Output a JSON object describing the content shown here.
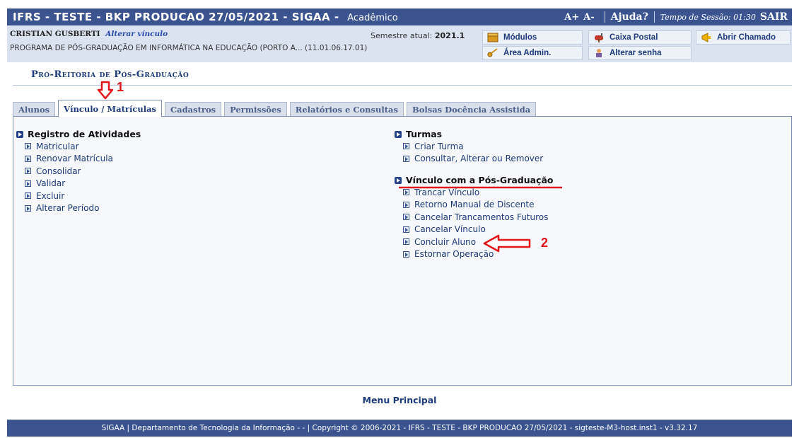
{
  "header": {
    "title": "IFRS - TESTE - BKP PRODUCAO 27/05/2021 - SIGAA -",
    "subsystem": "Acadêmico",
    "font_increase": "A+",
    "font_decrease": "A-",
    "help": "Ajuda?",
    "session": "Tempo de Sessão: 01:30",
    "logout": "SAIR"
  },
  "user_info": {
    "name": "CRISTIAN GUSBERTI",
    "change_link": "Alterar vínculo",
    "program": "PROGRAMA DE PÓS-GRADUAÇÃO EM INFORMÁTICA NA EDUCAÇÃO (PORTO A... (11.01.06.17.01)",
    "semester_label": "Semestre atual:",
    "semester_value": "2021.1"
  },
  "shortcuts": {
    "modulos": "Módulos",
    "caixa_postal": "Caixa Postal",
    "abrir_chamado": "Abrir Chamado",
    "area_admin": "Área Admin.",
    "alterar_senha": "Alterar senha"
  },
  "section_title": "Pró-Reitoria de Pós-Graduação",
  "tabs": [
    {
      "label": "Alunos"
    },
    {
      "label": "Vínculo / Matrículas"
    },
    {
      "label": "Cadastros"
    },
    {
      "label": "Permissões"
    },
    {
      "label": "Relatórios e Consultas"
    },
    {
      "label": "Bolsas Docência Assistida"
    }
  ],
  "active_tab": "Vínculo / Matrículas",
  "menus": {
    "registro": {
      "title": "Registro de Atividades",
      "items": [
        "Matricular",
        "Renovar Matrícula",
        "Consolidar",
        "Validar",
        "Excluir",
        "Alterar Período"
      ]
    },
    "turmas": {
      "title": "Turmas",
      "items": [
        "Criar Turma",
        "Consultar, Alterar ou Remover"
      ]
    },
    "vinculo": {
      "title": "Vínculo com a Pós-Graduação",
      "items": [
        "Trancar Vínculo",
        "Retorno Manual de Discente",
        "Cancelar Trancamentos Futuros",
        "Cancelar Vínculo",
        "Concluir Aluno",
        "Estornar Operação"
      ]
    }
  },
  "annotations": {
    "step1": "1",
    "step2": "2"
  },
  "menu_principal": "Menu Principal",
  "footer": "SIGAA | Departamento de Tecnologia da Informação - - | Copyright © 2006-2021 - IFRS - TESTE - BKP PRODUCAO 27/05/2021 - sigteste-M3-host.inst1 - v3.32.17",
  "colors": {
    "header_bg": "#3b5490",
    "info_bg": "#dbe3f1",
    "link": "#1d3a7a",
    "annotation": "#e3141b"
  }
}
